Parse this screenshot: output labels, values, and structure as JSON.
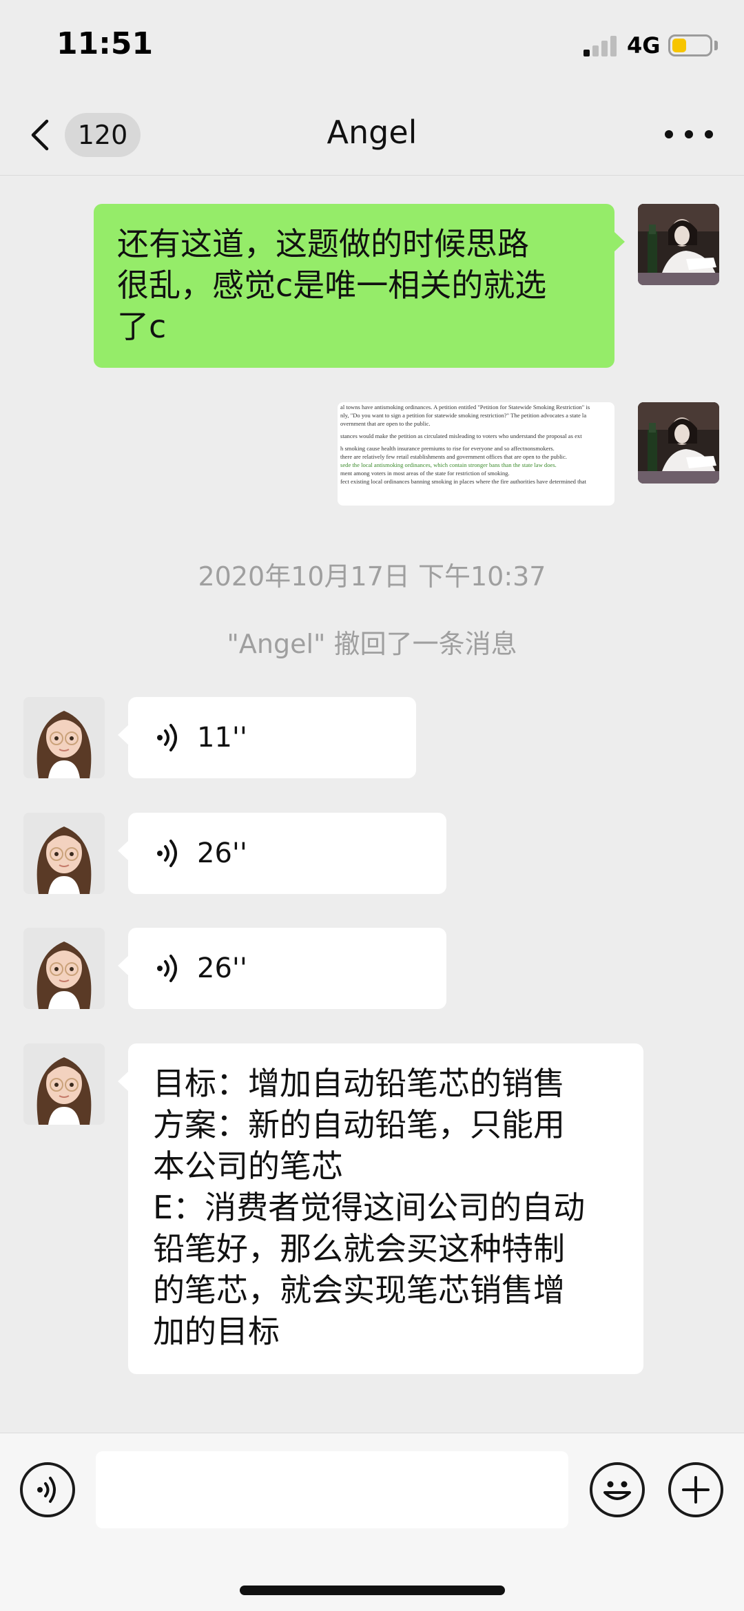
{
  "status_bar": {
    "time": "11:51",
    "network": "4G",
    "signal_bars_filled": 1,
    "battery_color": "#f7c500"
  },
  "nav": {
    "unread_count": "120",
    "title": "Angel"
  },
  "messages": {
    "sent_text": {
      "lines": [
        "还有这道，这题做的时候思路",
        "很乱，感觉c是唯一相关的就选",
        "了c"
      ]
    },
    "sent_image": {
      "lines": [
        "al towns have antismoking ordinances. A petition entitled \"Petition for Statewide Smoking Restriction\" is",
        "nly, \"Do you want to sign a petition for statewide smoking restriction?\" The petition advocates a state la",
        "overnment that are open to the public.",
        "",
        "stances would make the petition as circulated misleading to voters who understand the proposal as ext",
        "",
        "h smoking cause health insurance premiums to rise for everyone and so affectnonsmokers.",
        "there are relatively few retail establishments and government offices that are open to the public.",
        "sede the local antismoking ordinances, which contain stronger bans than the state law does.",
        "ment among voters in most areas of the state for restriction of smoking.",
        "fect existing local ordinances banning smoking in places where the fire authorities have determined that"
      ]
    },
    "timestamp_1": "2020年10月17日 下午10:37",
    "recall_notice": "\"Angel\" 撤回了一条消息",
    "voice_1": {
      "duration": "11''"
    },
    "voice_2": {
      "duration": "26''"
    },
    "voice_3": {
      "duration": "26''"
    },
    "received_text": {
      "lines": [
        "目标：增加自动铅笔芯的销售",
        "方案：新的自动铅笔，只能用",
        "本公司的笔芯",
        "E：消费者觉得这间公司的自动",
        "铅笔好，那么就会买这种特制",
        "的笔芯，就会实现笔芯销售增",
        "加的目标"
      ]
    }
  },
  "colors": {
    "background": "#ededed",
    "sent_bubble": "#95ec69",
    "received_bubble": "#ffffff",
    "system_text": "#9f9f9f"
  },
  "icons": {
    "back": "chevron-left-icon",
    "more": "ellipsis-icon",
    "voice_mode": "voice-icon",
    "emoji": "smiley-icon",
    "add": "plus-circle-icon"
  }
}
